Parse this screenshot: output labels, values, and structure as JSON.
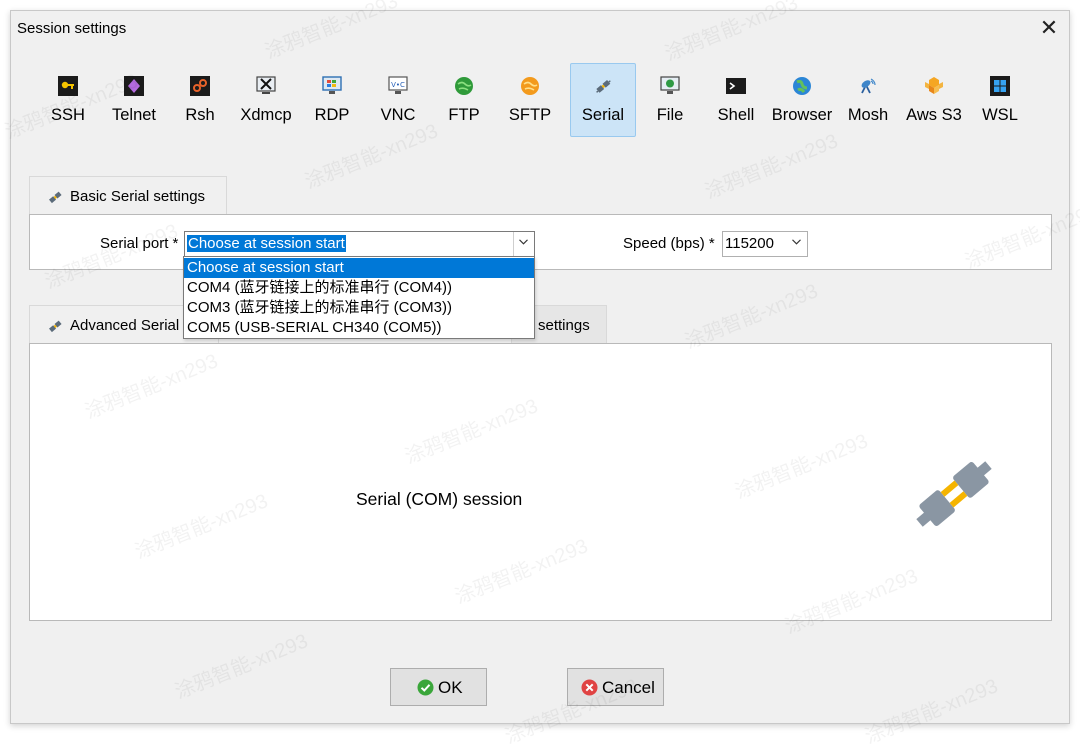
{
  "window": {
    "title": "Session settings",
    "close_glyph": "✕"
  },
  "protocols": [
    {
      "label": "SSH",
      "icon": "ssh-key-icon"
    },
    {
      "label": "Telnet",
      "icon": "telnet-icon"
    },
    {
      "label": "Rsh",
      "icon": "rsh-icon"
    },
    {
      "label": "Xdmcp",
      "icon": "xdmcp-icon"
    },
    {
      "label": "RDP",
      "icon": "rdp-monitor-icon"
    },
    {
      "label": "VNC",
      "icon": "vnc-icon"
    },
    {
      "label": "FTP",
      "icon": "ftp-globe-icon"
    },
    {
      "label": "SFTP",
      "icon": "sftp-icon"
    },
    {
      "label": "Serial",
      "icon": "serial-plug-icon",
      "selected": true
    },
    {
      "label": "File",
      "icon": "file-monitor-icon"
    },
    {
      "label": "Shell",
      "icon": "shell-terminal-icon"
    },
    {
      "label": "Browser",
      "icon": "browser-globe-icon"
    },
    {
      "label": "Mosh",
      "icon": "mosh-antenna-icon"
    },
    {
      "label": "Aws S3",
      "icon": "aws-s3-icon"
    },
    {
      "label": "WSL",
      "icon": "wsl-windows-icon"
    }
  ],
  "basic_tab": {
    "label": "Basic Serial settings",
    "serial_port_label": "Serial port *",
    "serial_port_value": "Choose at session start",
    "speed_label": "Speed (bps) *",
    "speed_value": "115200"
  },
  "serial_port_options": [
    "Choose at session start",
    "COM4  (蓝牙链接上的标准串行 (COM4))",
    "COM3  (蓝牙链接上的标准串行 (COM3))",
    "COM5  (USB-SERIAL CH340 (COM5))"
  ],
  "advanced_tab": {
    "label_visible": "Advanced Serial",
    "second_tab_visible": "settings"
  },
  "session_panel": {
    "text": "Serial (COM) session"
  },
  "buttons": {
    "ok": "OK",
    "cancel": "Cancel"
  },
  "watermark": "涂鸦智能-xn293",
  "colors": {
    "accent": "#0078d7",
    "selected_bg": "#cce4f7",
    "ok_green": "#3aa63a",
    "cancel_red": "#e04343",
    "plug_orange": "#f5b400"
  }
}
